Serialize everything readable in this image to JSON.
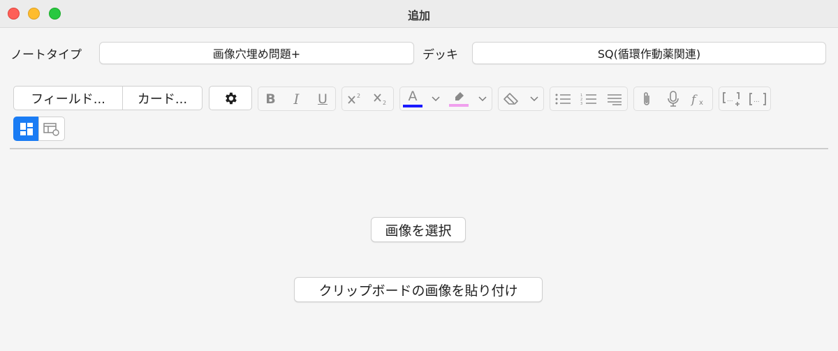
{
  "window": {
    "title": "追加"
  },
  "notetype": {
    "label": "ノートタイプ",
    "value": "画像穴埋め問題+"
  },
  "deck": {
    "label": "デッキ",
    "value": "SQ(循環作動薬関連)"
  },
  "toolbar": {
    "fields_label": "フィールド...",
    "cards_label": "カード...",
    "bold_glyph": "B",
    "italic_glyph": "I",
    "underline_glyph": "U",
    "text_color_glyph": "A",
    "text_color": "#1a1aff",
    "highlight_color": "#f0a0ee"
  },
  "main": {
    "select_image_label": "画像を選択",
    "paste_clipboard_label": "クリップボードの画像を貼り付け"
  },
  "colors": {
    "accent": "#1a7cf4"
  }
}
